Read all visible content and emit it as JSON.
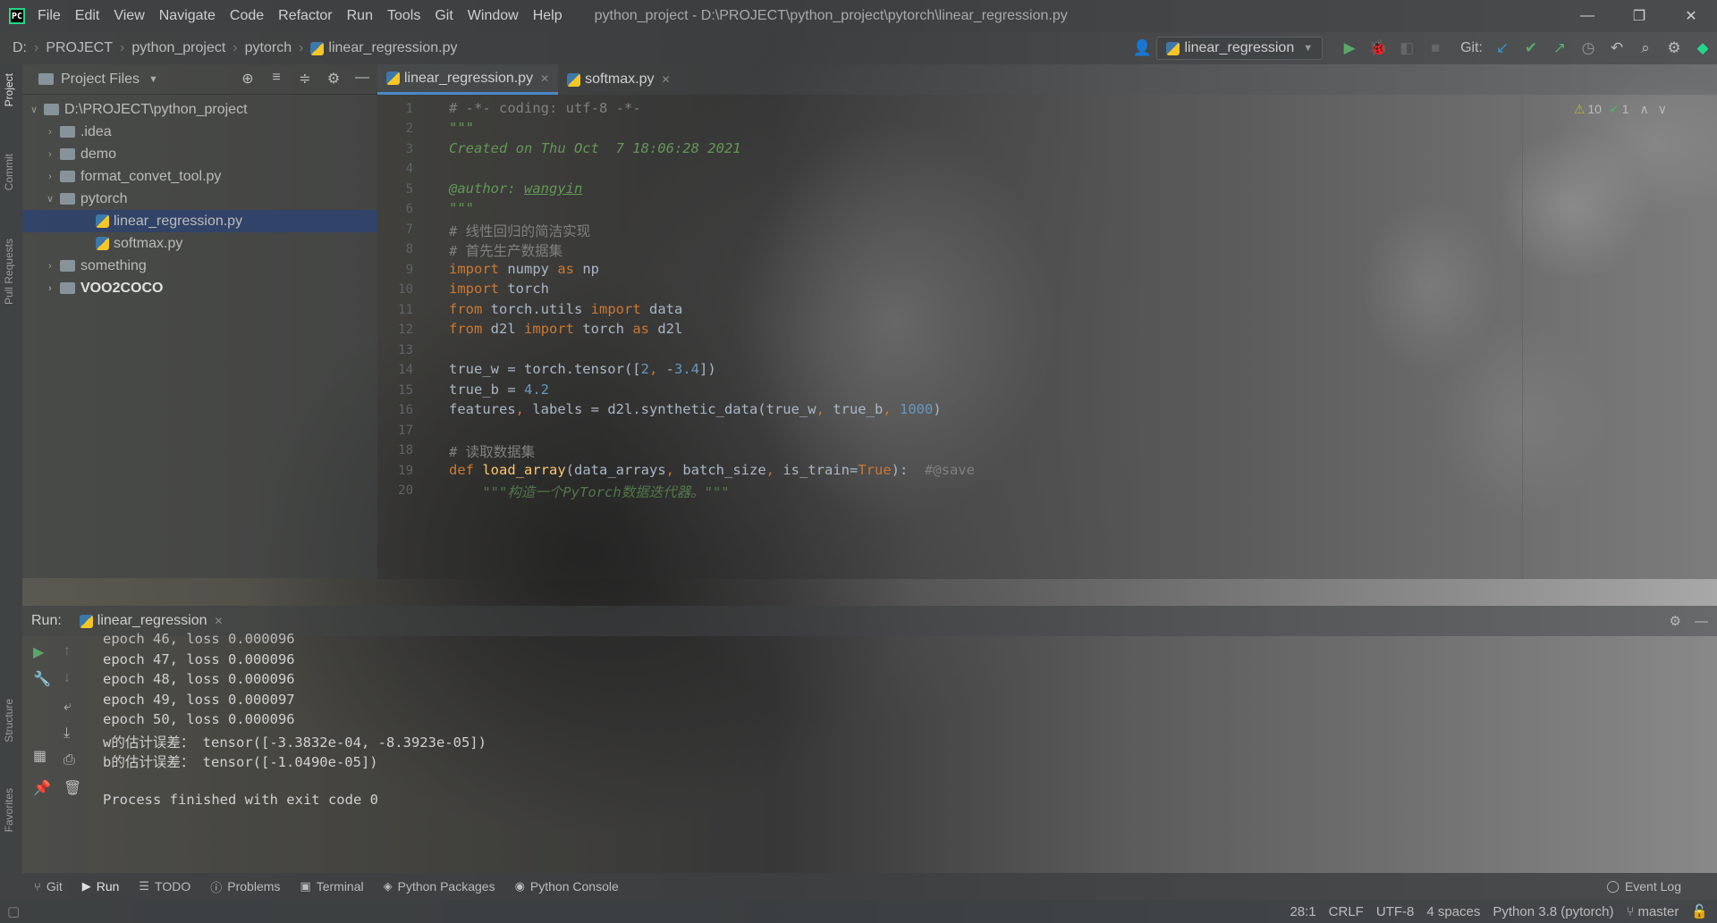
{
  "window": {
    "menu": [
      "File",
      "Edit",
      "View",
      "Navigate",
      "Code",
      "Refactor",
      "Run",
      "Tools",
      "Git",
      "Window",
      "Help"
    ],
    "title": "python_project - D:\\PROJECT\\python_project\\pytorch\\linear_regression.py",
    "controls": [
      "—",
      "❐",
      "✕"
    ]
  },
  "breadcrumb": [
    "D:",
    "PROJECT",
    "python_project",
    "pytorch",
    "linear_regression.py"
  ],
  "toolbar": {
    "run_config": "linear_regression",
    "git_label": "Git:"
  },
  "left_strip": [
    "Project",
    "Commit",
    "Pull Requests",
    "Structure",
    "Favorites"
  ],
  "project_panel": {
    "title": "Project Files",
    "tree": [
      {
        "label": "D:\\PROJECT\\python_project",
        "type": "folder",
        "expanded": true,
        "depth": 0
      },
      {
        "label": ".idea",
        "type": "folder",
        "depth": 1
      },
      {
        "label": "demo",
        "type": "folder",
        "depth": 1
      },
      {
        "label": "format_convet_tool.py",
        "type": "folder",
        "depth": 1
      },
      {
        "label": "pytorch",
        "type": "folder",
        "expanded": true,
        "depth": 1
      },
      {
        "label": "linear_regression.py",
        "type": "file",
        "selected": true,
        "depth": 2
      },
      {
        "label": "softmax.py",
        "type": "file",
        "depth": 2
      },
      {
        "label": "something",
        "type": "folder",
        "depth": 1
      },
      {
        "label": "VOO2COCO",
        "type": "folder",
        "depth": 1
      }
    ]
  },
  "editor": {
    "tabs": [
      {
        "label": "linear_regression.py",
        "active": true
      },
      {
        "label": "softmax.py",
        "active": false
      }
    ],
    "warnings": "10",
    "checks": "1",
    "line_numbers": [
      "1",
      "2",
      "3",
      "4",
      "5",
      "6",
      "7",
      "8",
      "9",
      "10",
      "11",
      "12",
      "13",
      "14",
      "15",
      "16",
      "17",
      "18",
      "19",
      "20"
    ]
  },
  "run_panel": {
    "label": "Run:",
    "config": "linear_regression",
    "output": [
      "epoch 46, loss 0.000096",
      "epoch 47, loss 0.000096",
      "epoch 48, loss 0.000096",
      "epoch 49, loss 0.000097",
      "epoch 50, loss 0.000096",
      "w的估计误差： tensor([-3.3832e-04, -8.3923e-05])",
      "b的估计误差： tensor([-1.0490e-05])",
      "",
      "Process finished with exit code 0"
    ]
  },
  "bottom_tabs": [
    "Git",
    "Run",
    "TODO",
    "Problems",
    "Terminal",
    "Python Packages",
    "Python Console"
  ],
  "event_log": "Event Log",
  "status": {
    "position": "28:1",
    "line_sep": "CRLF",
    "encoding": "UTF-8",
    "indent": "4 spaces",
    "interpreter": "Python 3.8 (pytorch)",
    "branch": "master"
  }
}
